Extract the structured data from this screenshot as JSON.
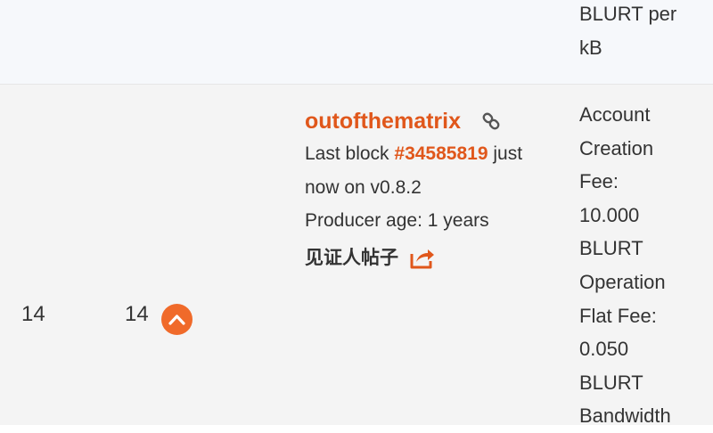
{
  "previous_row": {
    "params": [
      "BLURT per",
      "kB"
    ]
  },
  "witness_row": {
    "rank": "14",
    "votes": "14",
    "name": "outofthematrix",
    "last_block_prefix": "Last block ",
    "last_block_number": "#34585819",
    "last_block_suffix": " just",
    "last_block_line2": "now on v0.8.2",
    "producer_age": "Producer age: 1 years",
    "witness_post_label": "见证人帖子",
    "params": [
      "Account",
      "Creation",
      "Fee:",
      "10.000",
      "BLURT",
      "Operation",
      "Flat Fee:",
      "0.050",
      "BLURT",
      "Bandwidth"
    ]
  },
  "icons": {
    "upvote": "chevron-up-icon",
    "link": "link-icon",
    "share": "share-icon"
  },
  "colors": {
    "accent": "#e0571b",
    "upvote_bg": "#f06a2a",
    "row_bg": "#f4f4f4",
    "prev_row_bg": "#f6f8fb"
  }
}
